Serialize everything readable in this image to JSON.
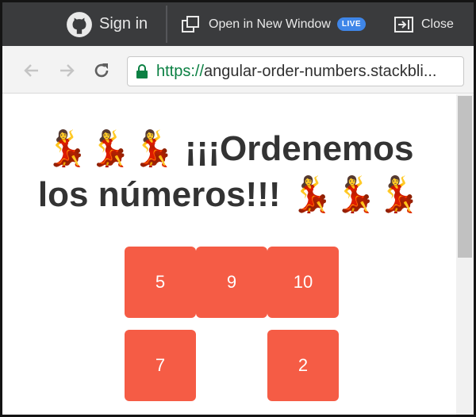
{
  "toolbar": {
    "sign_in": "Sign in",
    "open_new_window": "Open in New Window",
    "live_badge": "LIVE",
    "close": "Close"
  },
  "addressbar": {
    "url_scheme": "https://",
    "url_rest": "angular-order-numbers.stackbli..."
  },
  "page": {
    "title_emoji_left": "💃💃💃",
    "title_text": " ¡¡¡Ordenemos los números!!! ",
    "title_emoji_right": "💃💃💃"
  },
  "tiles": [
    {
      "value": "5"
    },
    {
      "value": "9"
    },
    {
      "value": "10"
    },
    {
      "value": "7"
    },
    {
      "value": "2"
    }
  ],
  "colors": {
    "toolbar_bg": "#3a3b3d",
    "live_badge": "#3f86e8",
    "tile": "#f55c45",
    "url_scheme": "#0b8043"
  },
  "icons": {
    "sign_in": "github-icon",
    "open_new_window": "new-window-icon",
    "close": "close-panel-icon",
    "back": "back-arrow-icon",
    "forward": "forward-arrow-icon",
    "reload": "reload-icon",
    "secure": "lock-icon"
  }
}
